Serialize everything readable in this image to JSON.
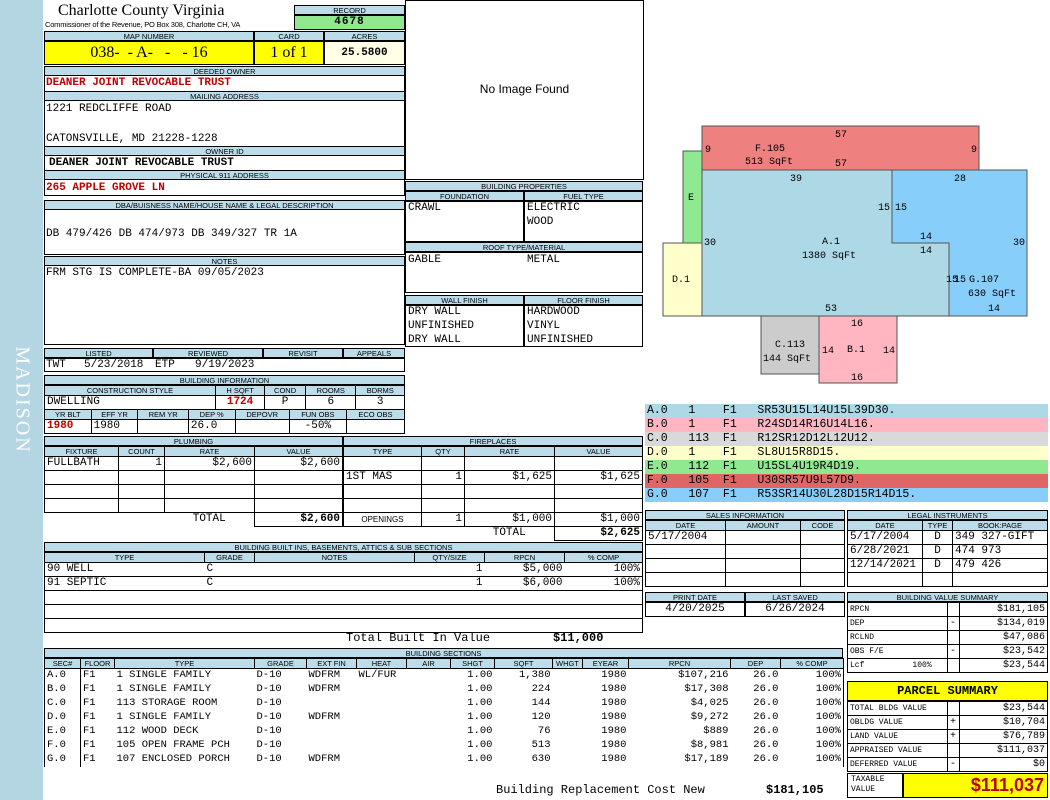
{
  "sidebar": {
    "district": "MADISON"
  },
  "header": {
    "county": "Charlotte County Virginia",
    "commissioner": "Commissioner of the Revenue, PO Box 308, Charlotte CH, VA",
    "record_label": "RECORD",
    "record": "4678"
  },
  "map": {
    "map_label": "MAP NUMBER",
    "map_number": "038-  - A-   -   - 16",
    "card_label": "CARD",
    "card": "1 of 1",
    "acres_label": "ACRES",
    "acres": "25.5800"
  },
  "owner": {
    "deeded_label": "DEEDED OWNER",
    "deeded": "DEANER JOINT REVOCABLE TRUST",
    "mailing_label": "MAILING ADDRESS",
    "address1": "1221 REDCLIFFE ROAD",
    "address2": "CATONSVILLE, MD 21228-1228",
    "owner_id_label": "OWNER ID",
    "owner_id": "DEANER JOINT REVOCABLE TRUST",
    "physical_label": "PHYSICAL 911 ADDRESS",
    "physical": "265 APPLE GROVE LN"
  },
  "legal": {
    "label": "DBA/BUISNESS NAME/HOUSE NAME & LEGAL DESCRIPTION",
    "text": "DB 479/426 DB 474/973 DB 349/327 TR 1A"
  },
  "notes": {
    "label": "NOTES",
    "text": "FRM STG IS COMPLETE-BA 09/05/2023"
  },
  "image": {
    "text": "No Image Found"
  },
  "listing": {
    "listed_label": "LISTED",
    "reviewed_label": "REVIEWED",
    "revisit_label": "REVISIT",
    "appeals_label": "APPEALS",
    "listed_by": "TWT",
    "listed_date": "5/23/2018",
    "reviewed_by": "ETP",
    "reviewed_date": "9/19/2023"
  },
  "building_info": {
    "label": "BUILDING INFORMATION",
    "style_label": "CONSTRUCTION STYLE",
    "hsqft_label": "H SQFT",
    "cond_label": "COND",
    "rooms_label": "ROOMS",
    "bdrms_label": "BDRMS",
    "style": "DWELLING",
    "hsqft": "1724",
    "cond": "P",
    "rooms": "6",
    "bdrms": "3",
    "yrblt_label": "YR BLT",
    "effyr_label": "EFF YR",
    "remyr_label": "REM YR",
    "dep_label": "DEP %",
    "depovr_label": "DEPOVR",
    "funobs_label": "FUN OBS",
    "ecoobs_label": "ECO OBS",
    "yrblt": "1980",
    "effyr": "1980",
    "dep": "26.0",
    "funobs": "-50%"
  },
  "building_props": {
    "label": "BUILDING PROPERTIES",
    "foundation_label": "FOUNDATION",
    "fuel_label": "FUEL TYPE",
    "foundation": "CRAWL",
    "fuel1": "ELECTRIC",
    "fuel2": "WOOD",
    "roof_label": "ROOF TYPE/MATERIAL",
    "roof1": "GABLE",
    "roof2": "METAL",
    "wall_label": "WALL FINISH",
    "floor_label": "FLOOR FINISH",
    "walls": [
      "DRY WALL",
      "UNFINISHED",
      "DRY WALL"
    ],
    "floors": [
      "HARDWOOD",
      "VINYL",
      "UNFINISHED"
    ]
  },
  "plumbing": {
    "label": "PLUMBING",
    "headers": [
      "FIXTURE",
      "COUNT",
      "RATE",
      "VALUE"
    ],
    "rows": [
      [
        "FULLBATH",
        "1",
        "$2,600",
        "$2,600"
      ]
    ],
    "total_label": "TOTAL",
    "total": "$2,600"
  },
  "fireplaces": {
    "label": "FIREPLACES",
    "headers": [
      "TYPE",
      "QTY",
      "RATE",
      "VALUE"
    ],
    "rows": [
      [
        "1ST MAS",
        "1",
        "$1,625",
        "$1,625"
      ]
    ],
    "openings_label": "OPENINGS",
    "openings_qty": "1",
    "openings_rate": "$1,000",
    "openings_value": "$1,000",
    "total_label": "TOTAL",
    "total": "$2,625"
  },
  "builtins": {
    "label": "BUILDING BUILT INS, BASEMENTS, ATTICS & SUB SECTIONS",
    "headers": [
      "TYPE",
      "GRADE",
      "NOTES",
      "QTY/SIZE",
      "RPCN",
      "% COMP"
    ],
    "rows": [
      [
        "90 WELL",
        "C",
        "",
        "1",
        "$5,000",
        "100%"
      ],
      [
        "91 SEPTIC",
        "C",
        "",
        "1",
        "$6,000",
        "100%"
      ]
    ],
    "total_label": "Total Built In Value",
    "total": "$11,000"
  },
  "sketch": {
    "areas": [
      {
        "id": "F.105",
        "sqft": "513 SqFt",
        "color": "#ee8080"
      },
      {
        "id": "E",
        "color": "#90e890"
      },
      {
        "id": "A.1",
        "sqft": "1380 SqFt",
        "color": "#add8e6"
      },
      {
        "id": "G.107",
        "sqft": "630 SqFt",
        "color": "#87cefa"
      },
      {
        "id": "D.1",
        "color": "#ffffcc"
      },
      {
        "id": "C.113",
        "sqft": "144 SqFt",
        "color": "#cccccc"
      },
      {
        "id": "B.1",
        "color": "#ffb6c1"
      }
    ],
    "dims": [
      "57",
      "9",
      "9",
      "57",
      "39",
      "28",
      "15",
      "15",
      "30",
      "14",
      "14",
      "30",
      "15",
      "15",
      "53",
      "14",
      "16",
      "14",
      "14",
      "16"
    ]
  },
  "sketch_codes": [
    {
      "code": "A.0   1    F1   SR53U15L14U15L39D30.",
      "color": "#add8e6"
    },
    {
      "code": "B.0   1    F1   R24SD14R16U14L16.",
      "color": "#ffb6c1"
    },
    {
      "code": "C.0   113  F1   R12SR12D12L12U12.",
      "color": "#d9d9d9"
    },
    {
      "code": "D.0   1    F1   SL8U15R8D15.",
      "color": "#ffffcc"
    },
    {
      "code": "E.0   112  F1   U15SL4U19R4D19.",
      "color": "#90e890"
    },
    {
      "code": "F.0   105  F1   U30SR57U9L57D9.",
      "color": "#e06666"
    },
    {
      "code": "G.0   107  F1   R53SR14U30L28D15R14D15.",
      "color": "#87cefa"
    }
  ],
  "sales": {
    "label": "SALES INFORMATION",
    "headers": [
      "DATE",
      "AMOUNT",
      "CODE"
    ],
    "rows": [
      [
        "5/17/2004",
        "",
        ""
      ]
    ]
  },
  "legal_instruments": {
    "label": "LEGAL INSTRUMENTS",
    "headers": [
      "DATE",
      "TYPE",
      "BOOK:PAGE"
    ],
    "rows": [
      [
        "5/17/2004",
        "D",
        "349 327-GIFT"
      ],
      [
        "6/28/2021",
        "D",
        "474 973"
      ],
      [
        "12/14/2021",
        "D",
        "479 426"
      ]
    ]
  },
  "print": {
    "print_label": "PRINT DATE",
    "saved_label": "LAST SAVED",
    "print_date": "4/20/2025",
    "saved_date": "6/26/2024"
  },
  "value_summary": {
    "label": "BUILDING VALUE SUMMARY",
    "rows": [
      [
        "RPCN",
        "",
        "$181,105"
      ],
      [
        "DEP",
        "-",
        "$134,019"
      ],
      [
        "RCLND",
        "",
        "$47,086"
      ],
      [
        "OBS F/E",
        "-",
        "$23,542"
      ],
      [
        "Lcf          100%",
        "",
        "$23,544"
      ]
    ]
  },
  "parcel": {
    "label": "PARCEL SUMMARY",
    "rows": [
      [
        "TOTAL BLDG VALUE",
        "",
        "$23,544"
      ],
      [
        "OBLDG VALUE",
        "+",
        "$10,704"
      ],
      [
        "LAND VALUE",
        "+",
        "$76,789"
      ],
      [
        "APPRAISED VALUE",
        "",
        "$111,037"
      ],
      [
        "DEFERRED VALUE",
        "-",
        "$0"
      ]
    ],
    "taxable_label": "TAXABLE VALUE",
    "taxable": "$111,037"
  },
  "sections": {
    "label": "BUILDING SECTIONS",
    "headers": [
      "SEC#",
      "FLOOR",
      "TYPE",
      "GRADE",
      "EXT FIN",
      "HEAT",
      "AIR",
      "SHGT",
      "SQFT",
      "WHGT",
      "EYEAR",
      "RPCN",
      "DEP",
      "% COMP"
    ],
    "rows": [
      [
        "A.0",
        "F1",
        "1 SINGLE FAMILY",
        "D-10",
        "WDFRM",
        "WL/FUR",
        "",
        "1.00",
        "1,380",
        "",
        "1980",
        "$107,216",
        "26.0",
        "100%"
      ],
      [
        "B.0",
        "F1",
        "1 SINGLE FAMILY",
        "D-10",
        "WDFRM",
        "",
        "",
        "1.00",
        "224",
        "",
        "1980",
        "$17,308",
        "26.0",
        "100%"
      ],
      [
        "C.0",
        "F1",
        "113 STORAGE ROOM",
        "D-10",
        "",
        "",
        "",
        "1.00",
        "144",
        "",
        "1980",
        "$4,025",
        "26.0",
        "100%"
      ],
      [
        "D.0",
        "F1",
        "1 SINGLE FAMILY",
        "D-10",
        "WDFRM",
        "",
        "",
        "1.00",
        "120",
        "",
        "1980",
        "$9,272",
        "26.0",
        "100%"
      ],
      [
        "E.0",
        "F1",
        "112 WOOD DECK",
        "D-10",
        "",
        "",
        "",
        "1.00",
        "76",
        "",
        "1980",
        "$889",
        "26.0",
        "100%"
      ],
      [
        "F.0",
        "F1",
        "105 OPEN FRAME PCH",
        "D-10",
        "",
        "",
        "",
        "1.00",
        "513",
        "",
        "1980",
        "$8,981",
        "26.0",
        "100%"
      ],
      [
        "G.0",
        "F1",
        "107 ENCLOSED PORCH",
        "D-10",
        "WDFRM",
        "",
        "",
        "1.00",
        "630",
        "",
        "1980",
        "$17,189",
        "26.0",
        "100%"
      ]
    ],
    "total_label": "Building Replacement Cost New",
    "total": "$181,105"
  }
}
